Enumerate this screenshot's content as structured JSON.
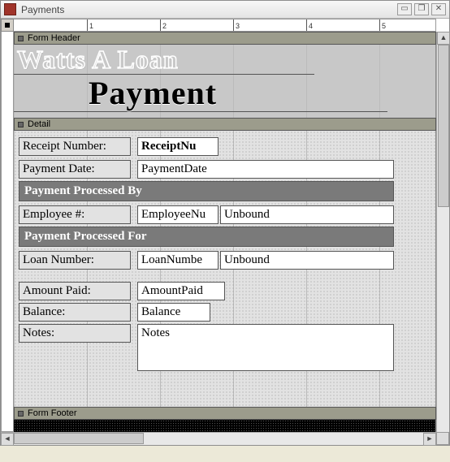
{
  "window": {
    "title": "Payments"
  },
  "sections": {
    "header_label": "Form Header",
    "detail_label": "Detail",
    "footer_label": "Form Footer"
  },
  "header": {
    "outline_title": "Watts A Loan",
    "big_title": "Payment"
  },
  "detail": {
    "receipt_number_label": "Receipt Number:",
    "receipt_number_field": "ReceiptNu",
    "payment_date_label": "Payment Date:",
    "payment_date_field": "PaymentDate",
    "processed_by_banner": "Payment Processed By",
    "employee_label": "Employee #:",
    "employee_field": "EmployeeNu",
    "employee_display": "Unbound",
    "processed_for_banner": "Payment Processed For",
    "loan_number_label": "Loan Number:",
    "loan_number_field": "LoanNumbe",
    "loan_display": "Unbound",
    "amount_paid_label": "Amount Paid:",
    "amount_paid_field": "AmountPaid",
    "balance_label": "Balance:",
    "balance_field": "Balance",
    "notes_label": "Notes:",
    "notes_field": "Notes"
  },
  "ruler_inches": [
    "1",
    "2",
    "3",
    "4",
    "5"
  ]
}
